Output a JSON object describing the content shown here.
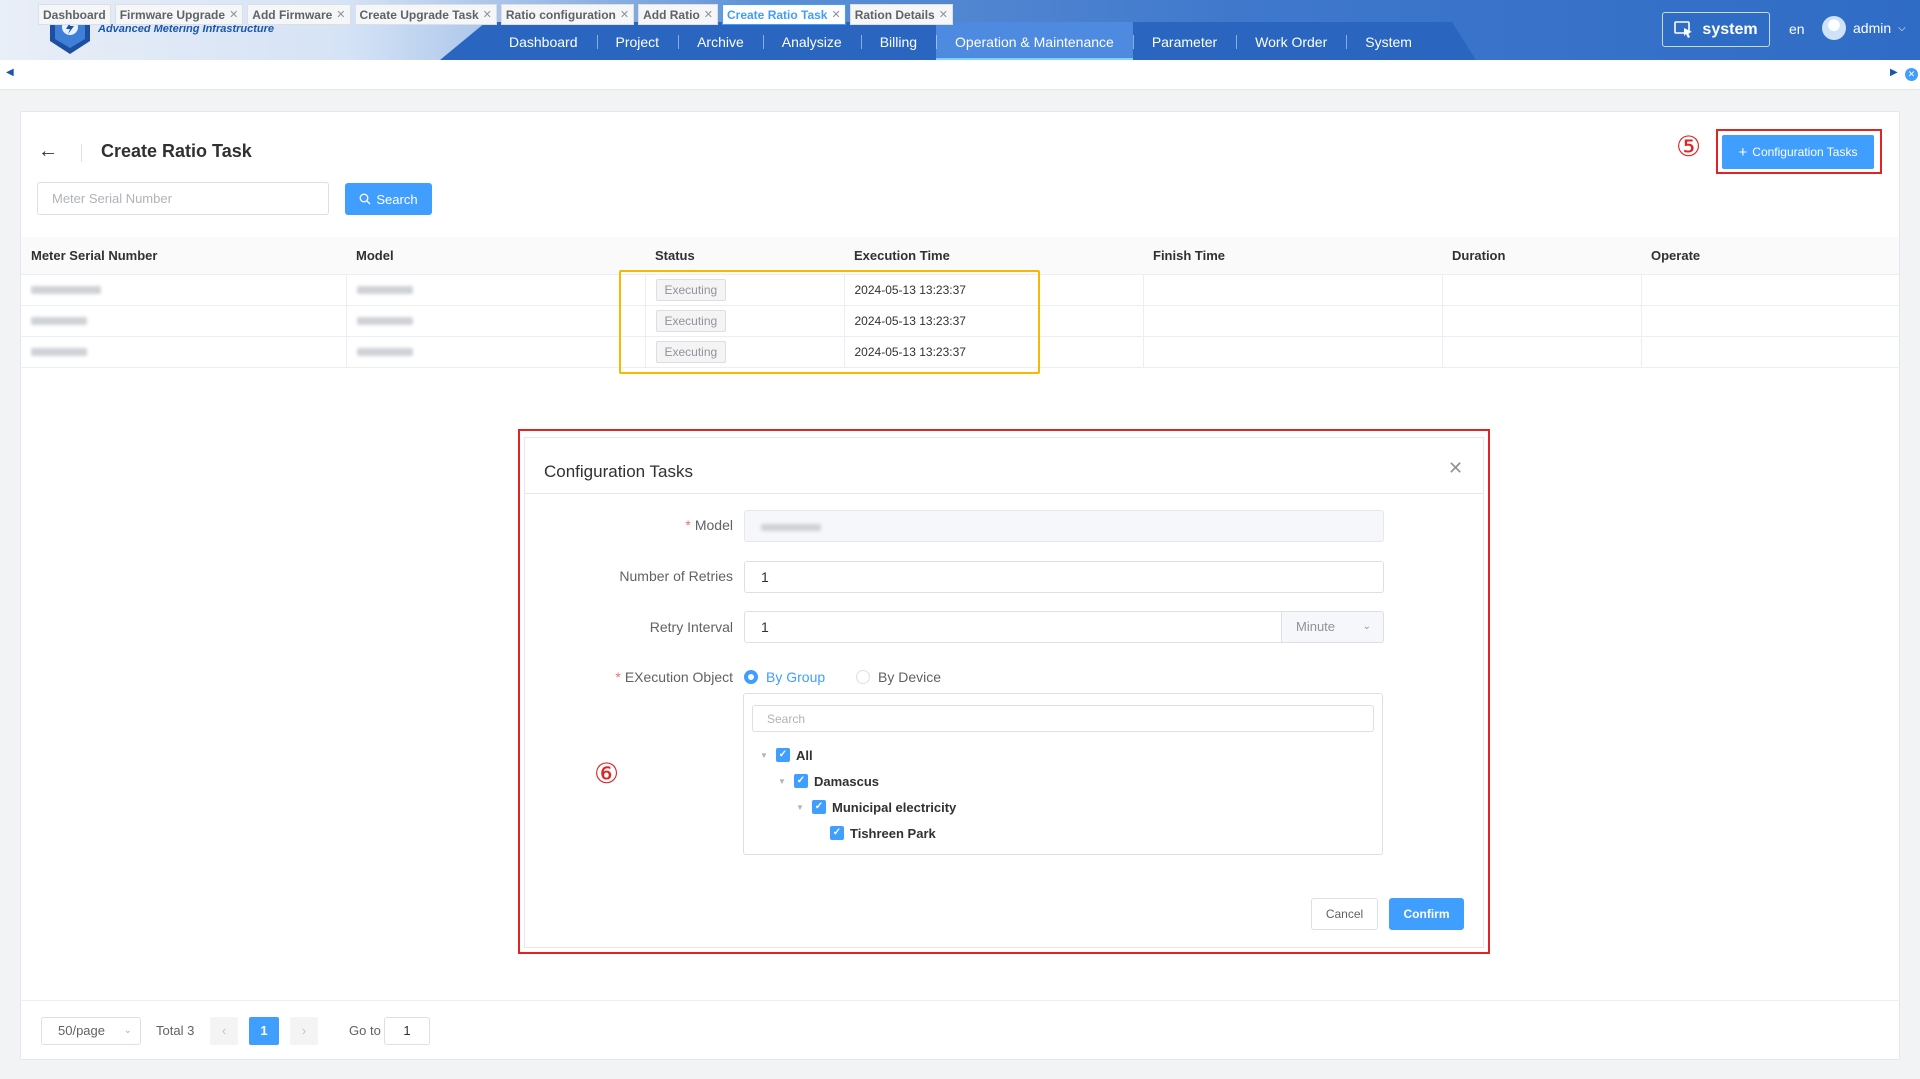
{
  "header": {
    "app_title": "Advanced Metering Infrastructure",
    "nav": [
      "Dashboard",
      "Project",
      "Archive",
      "Analysize",
      "Billing",
      "Operation & Maintenance",
      "Parameter",
      "Work Order",
      "System"
    ],
    "active_nav": "Operation & Maintenance",
    "system_label": "system",
    "language": "en",
    "user": "admin"
  },
  "tabs": [
    {
      "label": "Dashboard",
      "closable": false
    },
    {
      "label": "Firmware Upgrade",
      "closable": true
    },
    {
      "label": "Add Firmware",
      "closable": true
    },
    {
      "label": "Create Upgrade Task",
      "closable": true
    },
    {
      "label": "Ratio configuration",
      "closable": true
    },
    {
      "label": "Add Ratio",
      "closable": true
    },
    {
      "label": "Create Ratio Task",
      "closable": true,
      "active": true
    },
    {
      "label": "Ration Details",
      "closable": true
    }
  ],
  "page": {
    "title": "Create Ratio Task",
    "search_placeholder": "Meter Serial Number",
    "search_label": "Search",
    "config_button": "Configuration Tasks",
    "marker_5": "⑤",
    "marker_6": "⑥"
  },
  "table": {
    "columns": [
      "Meter Serial Number",
      "Model",
      "Status",
      "Execution Time",
      "Finish Time",
      "Duration",
      "Operate"
    ],
    "rows": [
      {
        "status": "Executing",
        "execution_time": "2024-05-13 13:23:37",
        "finish_time": "",
        "duration": "",
        "operate": ""
      },
      {
        "status": "Executing",
        "execution_time": "2024-05-13 13:23:37",
        "finish_time": "",
        "duration": "",
        "operate": ""
      },
      {
        "status": "Executing",
        "execution_time": "2024-05-13 13:23:37",
        "finish_time": "",
        "duration": "",
        "operate": ""
      }
    ]
  },
  "pagination": {
    "page_size": "50/page",
    "total": "Total 3",
    "current_page": "1",
    "goto_label": "Go to",
    "goto_value": "1"
  },
  "dialog": {
    "title": "Configuration Tasks",
    "model_label": "Model",
    "retries_label": "Number of Retries",
    "retries_value": "1",
    "interval_label": "Retry Interval",
    "interval_value": "1",
    "interval_unit": "Minute",
    "exec_label": "EXecution Object",
    "radio_group": "By Group",
    "radio_device": "By Device",
    "tree_search_placeholder": "Search",
    "tree": [
      "All",
      "Damascus",
      "Municipal electricity",
      "Tishreen Park"
    ],
    "cancel_label": "Cancel",
    "confirm_label": "Confirm"
  },
  "colors": {
    "primary": "#409eff",
    "annotation_red": "#e02424",
    "annotation_yellow": "#f5b900",
    "header_blue": "#2f6cc5"
  }
}
